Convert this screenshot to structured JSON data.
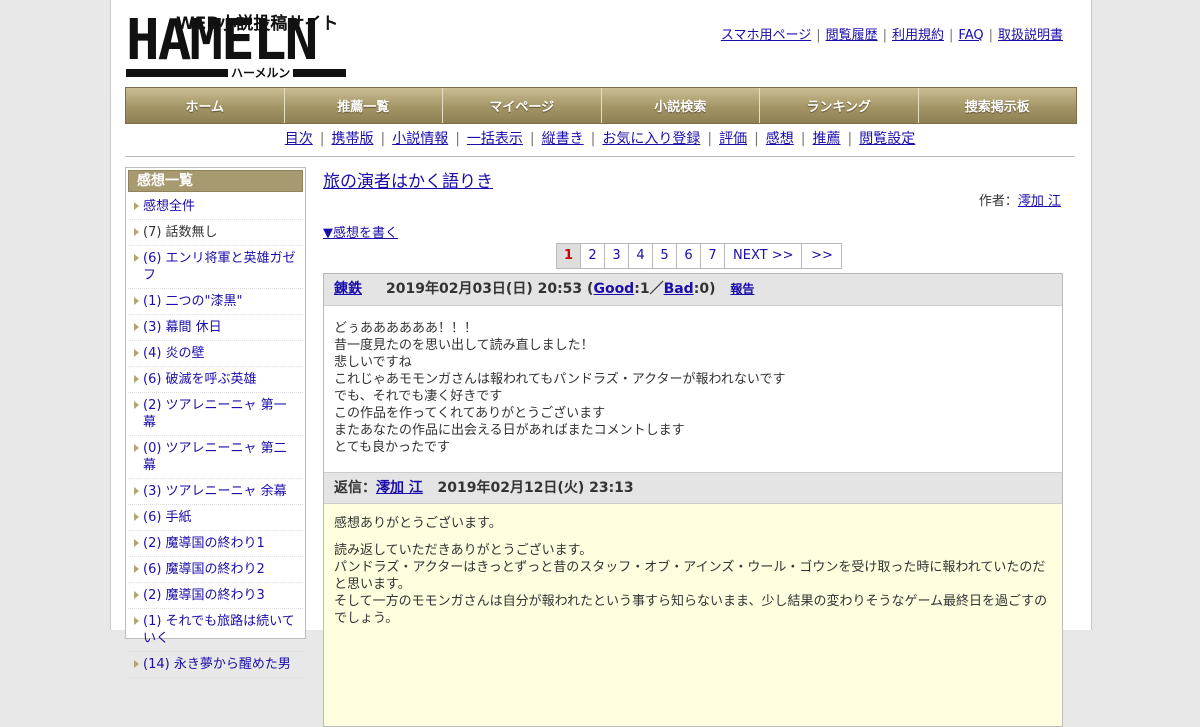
{
  "header": {
    "logo": {
      "tagline": "WEB小説投稿サイト",
      "name": "HAMELN",
      "kana": "ハーメルン"
    },
    "links": [
      "スマホ用ページ",
      "閲覧履歴",
      "利用規約",
      "FAQ",
      "取扱説明書"
    ]
  },
  "main_nav": [
    "ホーム",
    "推薦一覧",
    "マイページ",
    "小説検索",
    "ランキング",
    "捜索掲示板"
  ],
  "sub_nav": [
    "目次",
    "携帯版",
    "小説情報",
    "一括表示",
    "縦書き",
    "お気に入り登録",
    "評価",
    "感想",
    "推薦",
    "閲覧設定"
  ],
  "sidebar": {
    "title": "感想一覧",
    "items": [
      "感想全件",
      "(7) 話数無し",
      "(6) エンリ将軍と英雄ガゼフ",
      "(1) 二つの\"漆黒\"",
      "(3) 幕間 休日",
      "(4) 炎の壁",
      "(6) 破滅を呼ぶ英雄",
      "(2) ツアレニーニャ 第一幕",
      "(0) ツアレニーニャ 第二幕",
      "(3) ツアレニーニャ 余幕",
      "(6) 手紙",
      "(2) 魔導国の終わり1",
      "(6) 魔導国の終わり2",
      "(2) 魔導国の終わり3",
      "(1) それでも旅路は続いていく",
      "(14) 永き夢から醒めた男"
    ]
  },
  "novel": {
    "title": "旅の演者はかく語りき",
    "author_label": "作者：",
    "author": "澪加 江",
    "write_link": "▼感想を書く"
  },
  "pager": {
    "current": "1",
    "pages": [
      "2",
      "3",
      "4",
      "5",
      "6",
      "7"
    ],
    "next": "NEXT >>",
    "last": ">>"
  },
  "comment": {
    "user": "錬鉄",
    "date": "2019年02月03日(日) 20:53",
    "good_label": "Good",
    "good": "1",
    "bad_label": "Bad",
    "bad": "0",
    "report": "報告",
    "lines": [
      "どぅああああああ！！！",
      "昔一度見たのを思い出して読み直しました！",
      "悲しいですね",
      "これじゃあモモンガさんは報われてもパンドラズ・アクターが報われないです",
      "でも、それでも凄く好きです",
      "この作品を作ってくれてありがとうございます",
      "またあなたの作品に出会える日があればまたコメントします",
      "とても良かったです"
    ]
  },
  "reply": {
    "label": "返信：",
    "user": "澪加 江",
    "date": "2019年02月12日(火) 23:13",
    "para1": "感想ありがとうございます。",
    "lines": [
      "読み返していただきありがとうございます。",
      "パンドラズ・アクターはきっとずっと昔のスタッフ・オブ・アインズ・ウール・ゴウンを受け取った時に報われていたのだと思います。",
      "そして一方のモモンガさんは自分が報われたという事すら知らないまま、少し結果の変わりそうなゲーム最終日を過ごすのでしょう。"
    ]
  },
  "colors": {
    "nav_gold": "#a39565",
    "link": "#1a0dab",
    "reply_bg": "#ffffe0",
    "current_page": "#cc0000"
  }
}
